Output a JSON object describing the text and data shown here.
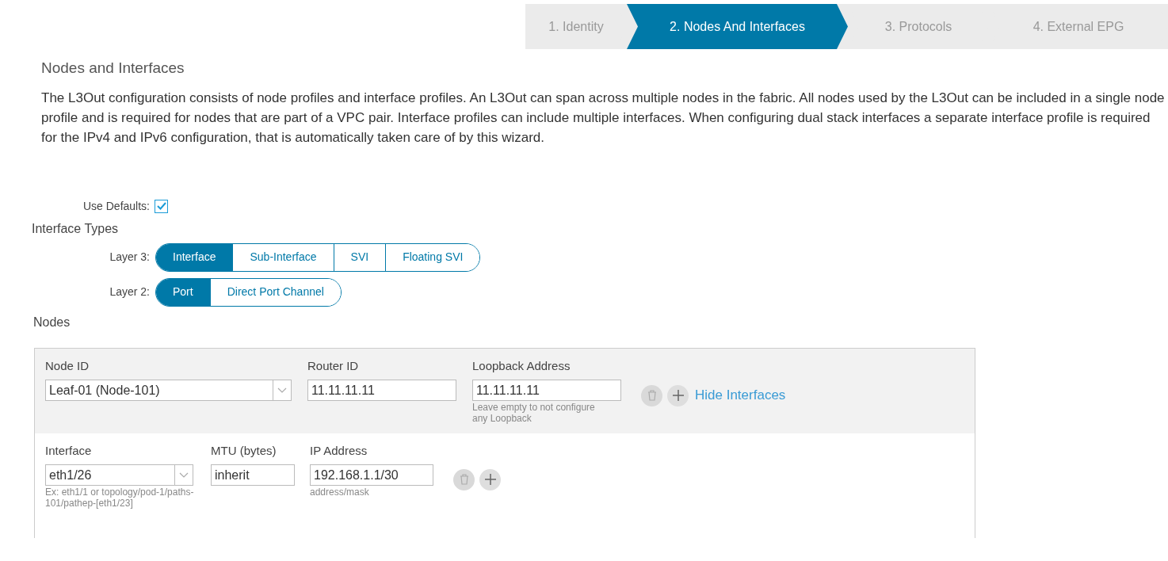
{
  "wizard": {
    "steps": [
      {
        "label": "1. Identity",
        "selected": false
      },
      {
        "label": "2. Nodes And Interfaces",
        "selected": true
      },
      {
        "label": "3. Protocols",
        "selected": false
      },
      {
        "label": "4. External EPG",
        "selected": false
      }
    ]
  },
  "section": {
    "title": "Nodes and Interfaces",
    "description": "The L3Out configuration consists of node profiles and interface profiles. An L3Out can span across multiple nodes in the fabric. All nodes used by the L3Out can be included in a single node profile and is required for nodes that are part of a VPC pair. Interface profiles can include multiple interfaces. When configuring dual stack interfaces a separate interface profile is required for the IPv4 and IPv6 configuration, that is automatically taken care of by this wizard."
  },
  "use_defaults": {
    "label": "Use Defaults:",
    "checked": true
  },
  "interface_types": {
    "title": "Interface Types",
    "groups": [
      {
        "label": "Layer 3:",
        "options": [
          {
            "label": "Interface",
            "selected": true
          },
          {
            "label": "Sub-Interface",
            "selected": false
          },
          {
            "label": "SVI",
            "selected": false
          },
          {
            "label": "Floating SVI",
            "selected": false
          }
        ]
      },
      {
        "label": "Layer 2:",
        "options": [
          {
            "label": "Port",
            "selected": true
          },
          {
            "label": "Direct Port Channel",
            "selected": false
          }
        ]
      }
    ]
  },
  "nodes": {
    "title": "Nodes",
    "node_row": {
      "fields": [
        {
          "kind": "select",
          "label": "Node ID",
          "value": "Leaf-01 (Node-101)"
        },
        {
          "kind": "text",
          "label": "Router ID",
          "value": "11.11.11.11"
        },
        {
          "kind": "text",
          "label": "Loopback Address",
          "value": "11.11.11.11",
          "help": "Leave empty to not configure any Loopback"
        }
      ],
      "delete_disabled": true,
      "link": "Hide Interfaces"
    },
    "interface_row": {
      "fields": [
        {
          "kind": "select",
          "label": "Interface",
          "value": "eth1/26",
          "help": "Ex: eth1/1 or topology/pod-1/paths-101/pathep-[eth1/23]"
        },
        {
          "kind": "text",
          "label": "MTU (bytes)",
          "value": "inherit"
        },
        {
          "kind": "text",
          "label": "IP Address",
          "value": "192.168.1.1/30",
          "help": "address/mask"
        }
      ],
      "delete_disabled": true
    }
  }
}
